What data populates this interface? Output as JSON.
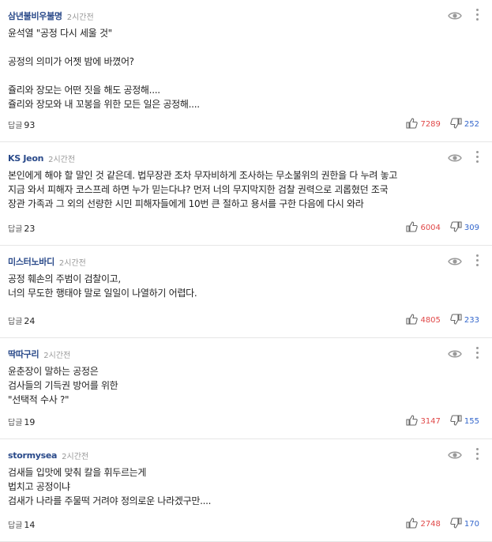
{
  "reply_label": "답글",
  "comments": [
    {
      "author": "삼년불비우불명",
      "time": "2시간전",
      "lines": [
        "윤석열 \"공정 다시 세울 것\"",
        "",
        "공정의 의미가 어젯 밤에 바꼈어?",
        "",
        "쥴리와 장모는 어떤 짓을 해도 공정해....",
        "쥴리와 장모와 내 꼬봉을 위한 모든 일은 공정해...."
      ],
      "replies": "93",
      "likes": "7289",
      "dislikes": "252"
    },
    {
      "author": "KS Jeon",
      "time": "2시간전",
      "lines": [
        "본인에게 해야 할 말인 것 같은데. 법무장관 조차 무자비하게 조사하는 무소불위의 권한을 다 누려 놓고",
        "지금 와서 피해자 코스프레 하면 누가 믿는다냐? 먼저 너의 무지막지한 검찰 권력으로 괴롭혔던 조국",
        "장관 가족과 그 외의 선량한 시민 피해자들에게 10번 큰 절하고 용서를 구한 다음에 다시 와라"
      ],
      "replies": "23",
      "likes": "6004",
      "dislikes": "309"
    },
    {
      "author": "미스터노바디",
      "time": "2시간전",
      "lines": [
        "공정 훼손의 주범이 검찰이고,",
        "너의 무도한 행태야 말로 일일이 나열하기 어렵다."
      ],
      "replies": "24",
      "likes": "4805",
      "dislikes": "233"
    },
    {
      "author": "딱따구리",
      "time": "2시간전",
      "lines": [
        "윤춘장이 말하는 공정은",
        "검사들의 기득권 방어를 위한",
        "\"선택적 수사 ?\""
      ],
      "replies": "19",
      "likes": "3147",
      "dislikes": "155"
    },
    {
      "author": "stormysea",
      "time": "2시간전",
      "lines": [
        "검새들 입맛에 맞춰 칼을 휘두르는게",
        "법치고 공정이냐",
        "검새가 나라를 주물떡 거려야 정의로운 나라겠구만...."
      ],
      "replies": "14",
      "likes": "2748",
      "dislikes": "170"
    }
  ]
}
